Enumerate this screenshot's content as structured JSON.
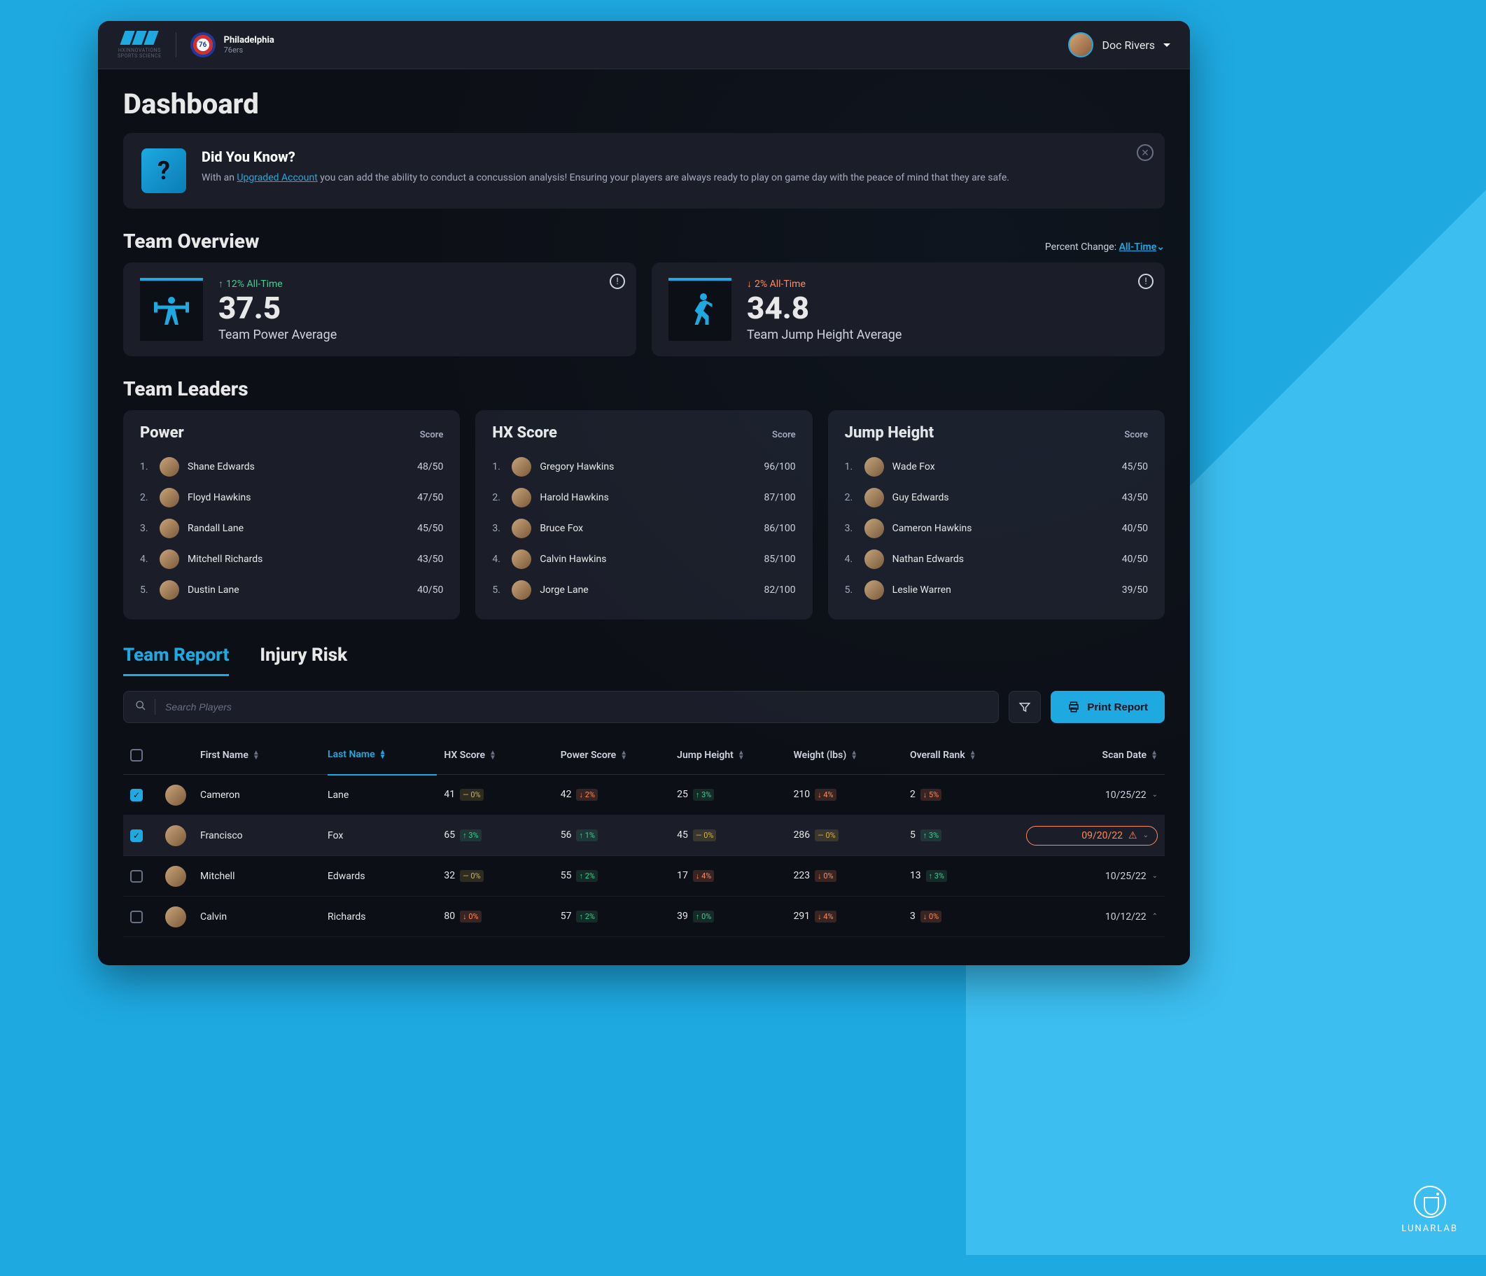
{
  "header": {
    "brandLine1": "HXINNOVATIONS",
    "brandLine2": "SPORTS SCIENCE",
    "teamCity": "Philadelphia",
    "teamName": "76ers",
    "userName": "Doc Rivers"
  },
  "page": {
    "title": "Dashboard"
  },
  "dyk": {
    "heading": "Did You Know?",
    "linkText": "Upgraded Account",
    "pre": "With an ",
    "post": " you can add the ability to conduct a concussion analysis! Ensuring your players are always ready to play on game day with the peace of mind that they are safe."
  },
  "overview": {
    "title": "Team Overview",
    "percentLabel": "Percent Change: ",
    "percentValue": "All-Time",
    "cards": {
      "power": {
        "delta": "12% All-Time",
        "dir": "up",
        "value": "37.5",
        "label": "Team Power Average"
      },
      "jump": {
        "delta": "2% All-Time",
        "dir": "down",
        "value": "34.8",
        "label": "Team Jump Height Average"
      }
    }
  },
  "leaders": {
    "title": "Team Leaders",
    "scoreLabel": "Score",
    "groups": {
      "power": {
        "title": "Power",
        "rows": [
          {
            "rank": "1.",
            "name": "Shane Edwards",
            "score": "48/50"
          },
          {
            "rank": "2.",
            "name": "Floyd Hawkins",
            "score": "47/50"
          },
          {
            "rank": "3.",
            "name": "Randall Lane",
            "score": "45/50"
          },
          {
            "rank": "4.",
            "name": "Mitchell Richards",
            "score": "43/50"
          },
          {
            "rank": "5.",
            "name": "Dustin Lane",
            "score": "40/50"
          }
        ]
      },
      "hx": {
        "title": "HX Score",
        "rows": [
          {
            "rank": "1.",
            "name": "Gregory Hawkins",
            "score": "96/100"
          },
          {
            "rank": "2.",
            "name": "Harold Hawkins",
            "score": "87/100"
          },
          {
            "rank": "3.",
            "name": "Bruce Fox",
            "score": "86/100"
          },
          {
            "rank": "4.",
            "name": "Calvin Hawkins",
            "score": "85/100"
          },
          {
            "rank": "5.",
            "name": "Jorge Lane",
            "score": "82/100"
          }
        ]
      },
      "jump": {
        "title": "Jump Height",
        "rows": [
          {
            "rank": "1.",
            "name": "Wade Fox",
            "score": "45/50"
          },
          {
            "rank": "2.",
            "name": "Guy Edwards",
            "score": "43/50"
          },
          {
            "rank": "3.",
            "name": "Cameron Hawkins",
            "score": "40/50"
          },
          {
            "rank": "4.",
            "name": "Nathan Edwards",
            "score": "40/50"
          },
          {
            "rank": "5.",
            "name": "Leslie Warren",
            "score": "39/50"
          }
        ]
      }
    }
  },
  "tabs": {
    "teamReport": "Team Report",
    "injuryRisk": "Injury Risk"
  },
  "search": {
    "placeholder": "Search Players"
  },
  "printBtn": "Print Report",
  "columns": {
    "firstName": "First Name",
    "lastName": "Last Name",
    "hx": "HX Score",
    "power": "Power Score",
    "jump": "Jump Height",
    "weight": "Weight (lbs)",
    "rank": "Overall Rank",
    "scan": "Scan Date"
  },
  "rows": [
    {
      "checked": true,
      "first": "Cameron",
      "last": "Lane",
      "hx": {
        "v": "41",
        "p": "0%",
        "d": "flat"
      },
      "power": {
        "v": "42",
        "p": "2%",
        "d": "down"
      },
      "jump": {
        "v": "25",
        "p": "3%",
        "d": "up"
      },
      "weight": {
        "v": "210",
        "p": "4%",
        "d": "down"
      },
      "rank": {
        "v": "2",
        "p": "5%",
        "d": "down"
      },
      "scan": "10/25/22",
      "scanDir": "down",
      "selected": false,
      "warn": false
    },
    {
      "checked": true,
      "first": "Francisco",
      "last": "Fox",
      "hx": {
        "v": "65",
        "p": "3%",
        "d": "up"
      },
      "power": {
        "v": "56",
        "p": "1%",
        "d": "up"
      },
      "jump": {
        "v": "45",
        "p": "0%",
        "d": "flat"
      },
      "weight": {
        "v": "286",
        "p": "0%",
        "d": "flat"
      },
      "rank": {
        "v": "5",
        "p": "3%",
        "d": "up"
      },
      "scan": "09/20/22",
      "scanDir": "down",
      "selected": true,
      "warn": true
    },
    {
      "checked": false,
      "first": "Mitchell",
      "last": "Edwards",
      "hx": {
        "v": "32",
        "p": "0%",
        "d": "flat"
      },
      "power": {
        "v": "55",
        "p": "2%",
        "d": "up"
      },
      "jump": {
        "v": "17",
        "p": "4%",
        "d": "down"
      },
      "weight": {
        "v": "223",
        "p": "0%",
        "d": "down"
      },
      "rank": {
        "v": "13",
        "p": "3%",
        "d": "up"
      },
      "scan": "10/25/22",
      "scanDir": "down",
      "selected": false,
      "warn": false
    },
    {
      "checked": false,
      "first": "Calvin",
      "last": "Richards",
      "hx": {
        "v": "80",
        "p": "0%",
        "d": "down"
      },
      "power": {
        "v": "57",
        "p": "2%",
        "d": "up"
      },
      "jump": {
        "v": "39",
        "p": "0%",
        "d": "up"
      },
      "weight": {
        "v": "291",
        "p": "4%",
        "d": "down"
      },
      "rank": {
        "v": "3",
        "p": "0%",
        "d": "down"
      },
      "scan": "10/12/22",
      "scanDir": "up",
      "selected": false,
      "warn": false
    }
  ],
  "lunarlab": "LUNARLAB"
}
